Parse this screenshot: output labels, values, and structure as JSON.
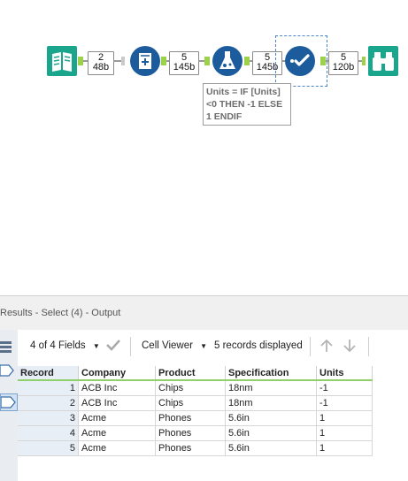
{
  "canvas": {
    "badges": [
      {
        "records": "2",
        "size": "48b"
      },
      {
        "records": "5",
        "size": "145b"
      },
      {
        "records": "5",
        "size": "145b"
      },
      {
        "records": "5",
        "size": "120b"
      }
    ],
    "annotation": {
      "line1": "Units = IF [Units]",
      "line2": "<0 THEN -1 ELSE",
      "line3": "1 ENDIF"
    },
    "colors": {
      "input_tool": "#1aa58d",
      "blue_tool": "#1d5c9c",
      "browse_tool": "#1aa58d",
      "anchor": "#9bd24a"
    }
  },
  "results": {
    "title": "Results - Select (4) - Output",
    "fields_label": "4 of 4 Fields",
    "cell_viewer_label": "Cell Viewer",
    "records_label": "5 records displayed",
    "columns": [
      "Record",
      "Company",
      "Product",
      "Specification",
      "Units"
    ],
    "rows": [
      [
        "1",
        "ACB Inc",
        "Chips",
        "18nm",
        "-1"
      ],
      [
        "2",
        "ACB Inc",
        "Chips",
        "18nm",
        "-1"
      ],
      [
        "3",
        "Acme",
        "Phones",
        "5.6in",
        "1"
      ],
      [
        "4",
        "Acme",
        "Phones",
        "5.6in",
        "1"
      ],
      [
        "5",
        "Acme",
        "Phones",
        "5.6in",
        "1"
      ]
    ]
  }
}
